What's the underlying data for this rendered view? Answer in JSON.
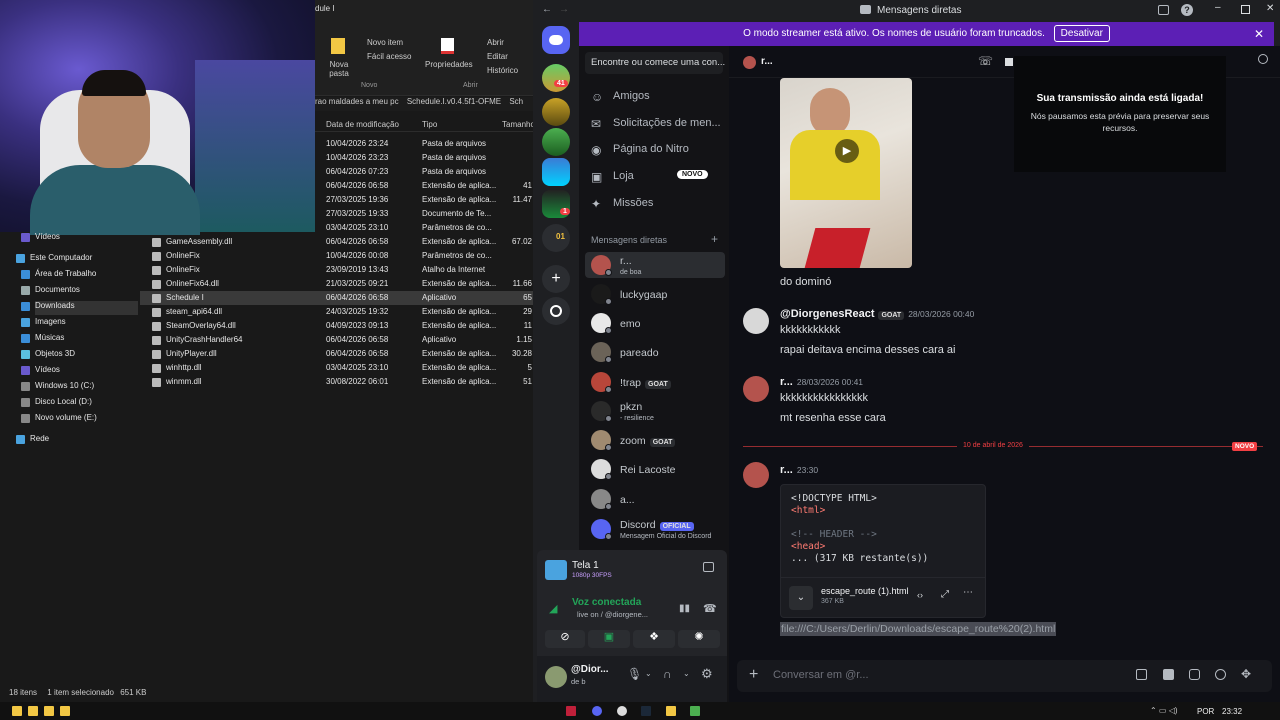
{
  "explorer": {
    "ribbon": {
      "title_fragment": "dule I",
      "new_item": "Novo item",
      "easy_access": "Fácil acesso",
      "new_folder": "Nova pasta",
      "properties": "Propriedades",
      "open": "Abrir",
      "edit": "Editar",
      "history": "Histórico",
      "group_new": "Novo",
      "group_open": "Abrir"
    },
    "breadcrumb": [
      "rao maldades a meu pc",
      "Schedule.I.v0.4.5f1-OFME",
      "Sch"
    ],
    "columns": {
      "date": "Data de modificação",
      "type": "Tipo",
      "size": "Tamanho"
    },
    "files": [
      {
        "name": "",
        "date": "10/04/2026 23:24",
        "type": "Pasta de arquivos",
        "size": ""
      },
      {
        "name": "",
        "date": "10/04/2026 23:23",
        "type": "Pasta de arquivos",
        "size": ""
      },
      {
        "name": "",
        "date": "06/04/2026 07:23",
        "type": "Pasta de arquivos",
        "size": ""
      },
      {
        "name": "",
        "date": "06/04/2026 06:58",
        "type": "Extensão de aplica...",
        "size": "41"
      },
      {
        "name": "",
        "date": "27/03/2025 19:36",
        "type": "Extensão de aplica...",
        "size": "11.47"
      },
      {
        "name": "",
        "date": "27/03/2025 19:33",
        "type": "Documento de Te...",
        "size": ""
      },
      {
        "name": "",
        "date": "03/04/2025 23:10",
        "type": "Parâmetros de co...",
        "size": ""
      },
      {
        "name": "GameAssembly.dll",
        "date": "06/04/2026 06:58",
        "type": "Extensão de aplica...",
        "size": "67.02"
      },
      {
        "name": "OnlineFix",
        "date": "10/04/2026 00:08",
        "type": "Parâmetros de co...",
        "size": ""
      },
      {
        "name": "OnlineFix",
        "date": "23/09/2019 13:43",
        "type": "Atalho da Internet",
        "size": ""
      },
      {
        "name": "OnlineFix64.dll",
        "date": "21/03/2025 09:21",
        "type": "Extensão de aplica...",
        "size": "11.66"
      },
      {
        "name": "Schedule I",
        "date": "06/04/2026 06:58",
        "type": "Aplicativo",
        "size": "65"
      },
      {
        "name": "steam_api64.dll",
        "date": "24/03/2025 19:32",
        "type": "Extensão de aplica...",
        "size": "29"
      },
      {
        "name": "SteamOverlay64.dll",
        "date": "04/09/2023 09:13",
        "type": "Extensão de aplica...",
        "size": "11"
      },
      {
        "name": "UnityCrashHandler64",
        "date": "06/04/2026 06:58",
        "type": "Aplicativo",
        "size": "1.15"
      },
      {
        "name": "UnityPlayer.dll",
        "date": "06/04/2026 06:58",
        "type": "Extensão de aplica...",
        "size": "30.28"
      },
      {
        "name": "winhttp.dll",
        "date": "03/04/2025 23:10",
        "type": "Extensão de aplica...",
        "size": "5"
      },
      {
        "name": "winmm.dll",
        "date": "30/08/2022 06:01",
        "type": "Extensão de aplica...",
        "size": "51"
      }
    ],
    "nav": [
      "Vídeos",
      "Este Computador",
      "Área de Trabalho",
      "Documentos",
      "Downloads",
      "Imagens",
      "Músicas",
      "Objetos 3D",
      "Vídeos",
      "Windows 10 (C:)",
      "Disco Local (D:)",
      "Novo volume (E:)",
      "Rede"
    ],
    "status": {
      "count": "18 itens",
      "selected": "1 item selecionado",
      "size": "651 KB"
    }
  },
  "discord": {
    "window_title": "Mensagens diretas",
    "streamer_text": "O modo streamer está ativo. Os nomes de usuário foram truncados.",
    "streamer_button": "Desativar",
    "search_placeholder": "Encontre ou comece uma con...",
    "guild_badges": [
      "41",
      "1",
      "01"
    ],
    "nav": {
      "friends": "Amigos",
      "requests": "Solicitações de men...",
      "nitro": "Página do Nitro",
      "shop": "Loja",
      "shop_badge": "NOVO",
      "missions": "Missões"
    },
    "dm_header": "Mensagens diretas",
    "dms": [
      {
        "name": "r...",
        "sub": "de boa",
        "color": "#b4534d"
      },
      {
        "name": "luckygaap",
        "sub": "",
        "color": "#1a1a1a"
      },
      {
        "name": "emo",
        "sub": "",
        "color": "#e8e8e8"
      },
      {
        "name": "pareado",
        "sub": "",
        "color": "#6b6358"
      },
      {
        "name": "!trap",
        "sub": "",
        "color": "#b8463a",
        "tag": "GOAT"
      },
      {
        "name": "pkzn",
        "sub": "- resilience",
        "color": "#2a2a2a"
      },
      {
        "name": "zoom",
        "sub": "",
        "color": "#a08a70",
        "tag": "GOAT"
      },
      {
        "name": "Rei Lacoste",
        "sub": "",
        "color": "#dcdcdc"
      },
      {
        "name": "a...",
        "sub": "",
        "color": "#888888"
      },
      {
        "name": "Discord",
        "sub": "Mensagem Oficial do Discord",
        "color": "#5865f2",
        "tag": "OFICIAL"
      }
    ],
    "voice": {
      "screen_title": "Tela 1",
      "screen_quality": "1080p 30FPS",
      "connected": "Voz conectada",
      "channel": "live on / @diorgene...",
      "user_name": "@Dior...",
      "user_status": "de b"
    },
    "chat": {
      "recipient": "r...",
      "stream_notice_title": "Sua transmissão ainda está ligada!",
      "stream_notice_body": "Nós pausamos esta prévia para preservar seus recursos.",
      "messages": [
        {
          "text": "do dominó"
        },
        {
          "author": "@DiorgenesReact",
          "tag": "GOAT",
          "time": "28/03/2026 00:40",
          "lines": [
            "kkkkkkkkkkk",
            "rapai deitava encima desses cara ai"
          ]
        },
        {
          "author": "r...",
          "time": "28/03/2026 00:41",
          "lines": [
            "kkkkkkkkkkkkkkkk",
            "mt resenha esse cara"
          ]
        }
      ],
      "divider_date": "10 de abril de 2026",
      "divider_badge": "NOVO",
      "last_author": "r...",
      "last_time": "23:30",
      "code_lines": [
        "<!DOCTYPE HTML>",
        "<html>",
        "",
        "<!-- HEADER -->",
        "<head>",
        "... (317 KB restante(s))"
      ],
      "attachment_name": "escape_route (1).html",
      "attachment_size": "367 KB",
      "selected_link": "file:///C:/Users/Derlin/Downloads/escape_route%20(2).html",
      "composer_placeholder": "Conversar em @r..."
    }
  },
  "taskbar": {
    "lang": "POR",
    "clock": "23:32"
  },
  "colors": {
    "blurple": "#5865f2",
    "streamer_bar": "#5c1fb5",
    "new_red": "#f23f43",
    "online_green": "#23a559"
  }
}
